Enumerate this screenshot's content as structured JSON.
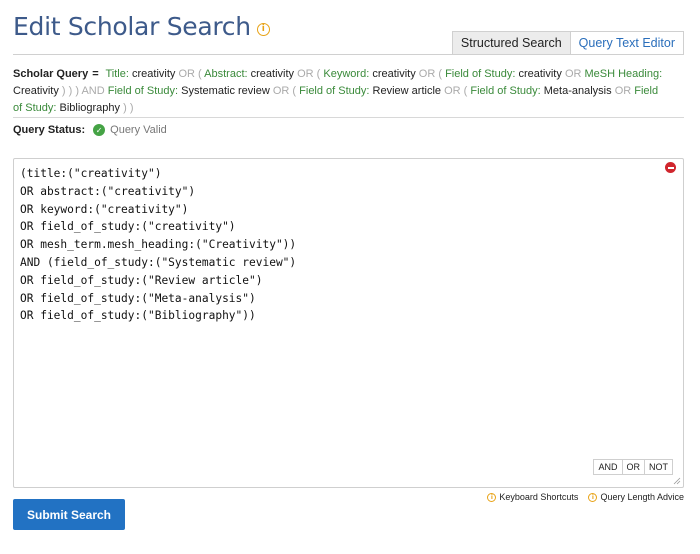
{
  "header": {
    "title": "Edit Scholar Search",
    "info_icon": "i"
  },
  "tabs": [
    {
      "label": "Structured Search",
      "active": false
    },
    {
      "label": "Query Text Editor",
      "active": true
    }
  ],
  "summary": {
    "label": "Scholar Query",
    "eq": "=",
    "tokens": {
      "t1": "Title:",
      "t2": "creativity",
      "t3": "OR (",
      "t4": "Abstract:",
      "t5": "creativity",
      "t6": "OR (",
      "t7": "Keyword:",
      "t8": "creativity",
      "t9": "OR (",
      "t10": "Field of Study:",
      "t11": "creativity",
      "t12": "OR",
      "t13": "MeSH Heading:",
      "t14": "Creativity",
      "t15": ") ) )",
      "t16": "AND",
      "t17": "Field of Study:",
      "t18": "Systematic review",
      "t19": "OR (",
      "t20": "Field of Study:",
      "t21": "Review article",
      "t22": "OR (",
      "t23": "Field of Study:",
      "t24": "Meta-analysis",
      "t25": "OR",
      "t26": "Field of",
      "t27": "Study:",
      "t28": "Bibliography",
      "t29": ") )"
    }
  },
  "status": {
    "label": "Query Status:",
    "value": "Query Valid"
  },
  "editor": {
    "lines": [
      "(title:(\"creativity\")",
      "OR abstract:(\"creativity\")",
      "OR keyword:(\"creativity\")",
      "OR field_of_study:(\"creativity\")",
      "OR mesh_term.mesh_heading:(\"Creativity\"))",
      "AND (field_of_study:(\"Systematic review\")",
      "OR field_of_study:(\"Review article\")",
      "OR field_of_study:(\"Meta-analysis\")",
      "OR field_of_study:(\"Bibliography\"))"
    ],
    "operators": [
      "AND",
      "OR",
      "NOT"
    ]
  },
  "help": {
    "keyboard": "Keyboard Shortcuts",
    "length": "Query Length Advice"
  },
  "submit_label": "Submit Search",
  "colors": {
    "title": "#3d5a8a",
    "field": "#3a8a3a",
    "accent": "#2272c3",
    "valid": "#45a345",
    "remove": "#d0262d",
    "info": "#e8a317"
  }
}
